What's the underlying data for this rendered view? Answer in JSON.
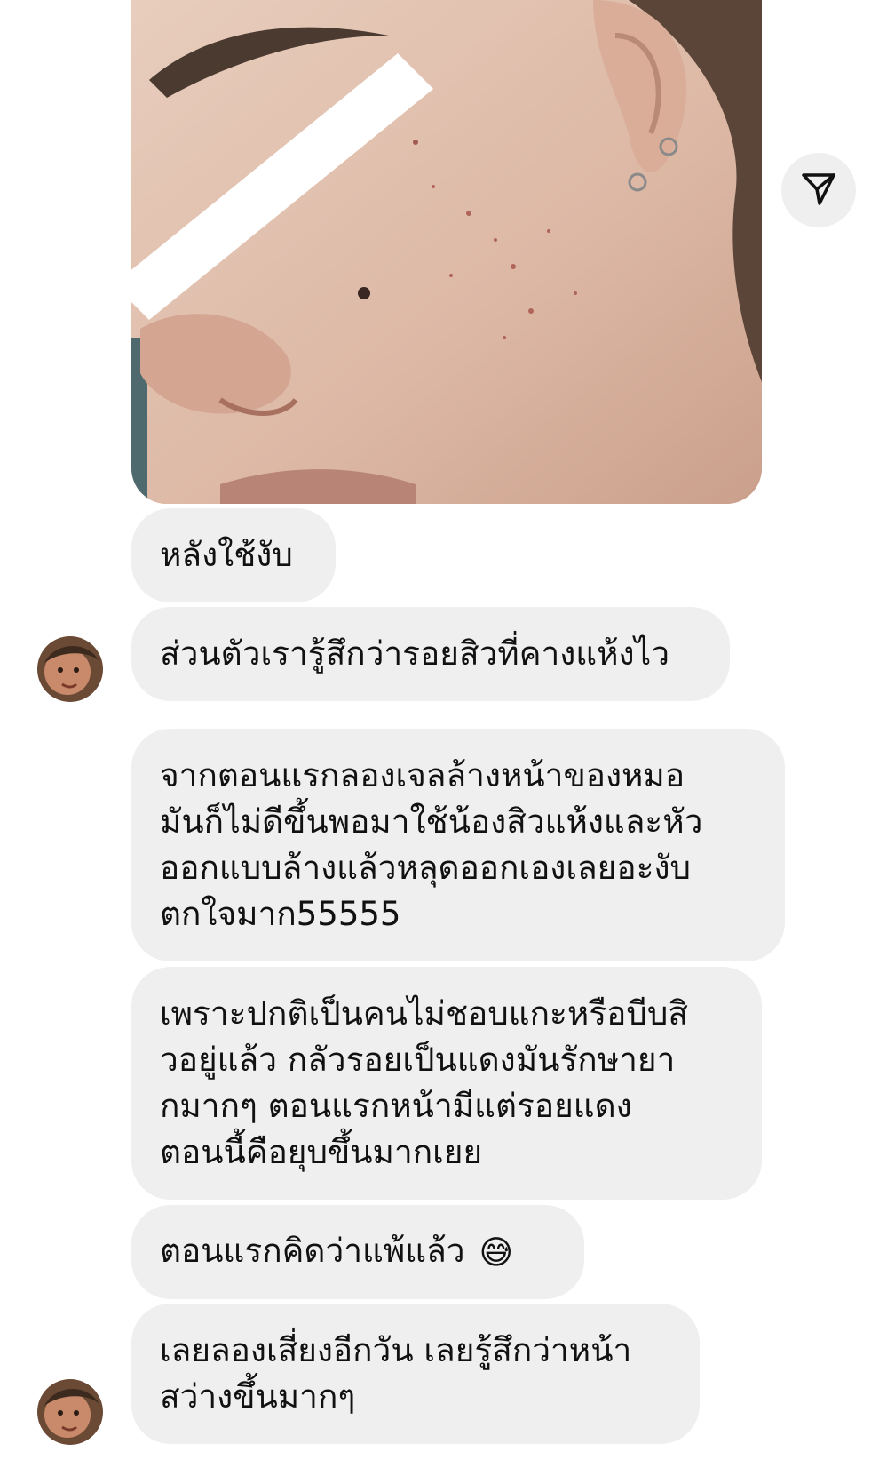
{
  "header": {
    "share_icon": "paper-plane-icon"
  },
  "photo": {
    "icon": "face-photo"
  },
  "messages": [
    {
      "lines": [
        "หลังใช้งับ"
      ]
    },
    {
      "lines": [
        "ส่วนตัวเรารู้สึกว่ารอยสิวที่คางแห้งไว"
      ]
    },
    {
      "lines": [
        "จากตอนแรกลองเจลล้างหน้าของหมอ",
        "มันก็ไม่ดีขึ้นพอมาใช้น้องสิวแห้งและหัว",
        "ออกแบบล้างแล้วหลุดออกเองเลยอะงับ",
        "ตกใจมาก55555"
      ]
    },
    {
      "lines": [
        "เพราะปกติเป็นคนไม่ชอบแกะหรือบีบสิ",
        "วอยู่แล้ว กลัวรอยเป็นแดงมันรักษายา",
        "กมากๆ ตอนแรกหน้ามีแต่รอยแดง",
        "ตอนนี้คือยุบขึ้นมากเยย"
      ]
    },
    {
      "lines": [
        "ตอนแรกคิดว่าแพ้แล้ว"
      ],
      "emoji": "😅"
    },
    {
      "lines": [
        "เลยลองเสี่ยงอีกวัน เลยรู้สึกว่าหน้า",
        "สว่างขึ้นมากๆ"
      ]
    }
  ],
  "avatar_icon": "user-avatar"
}
